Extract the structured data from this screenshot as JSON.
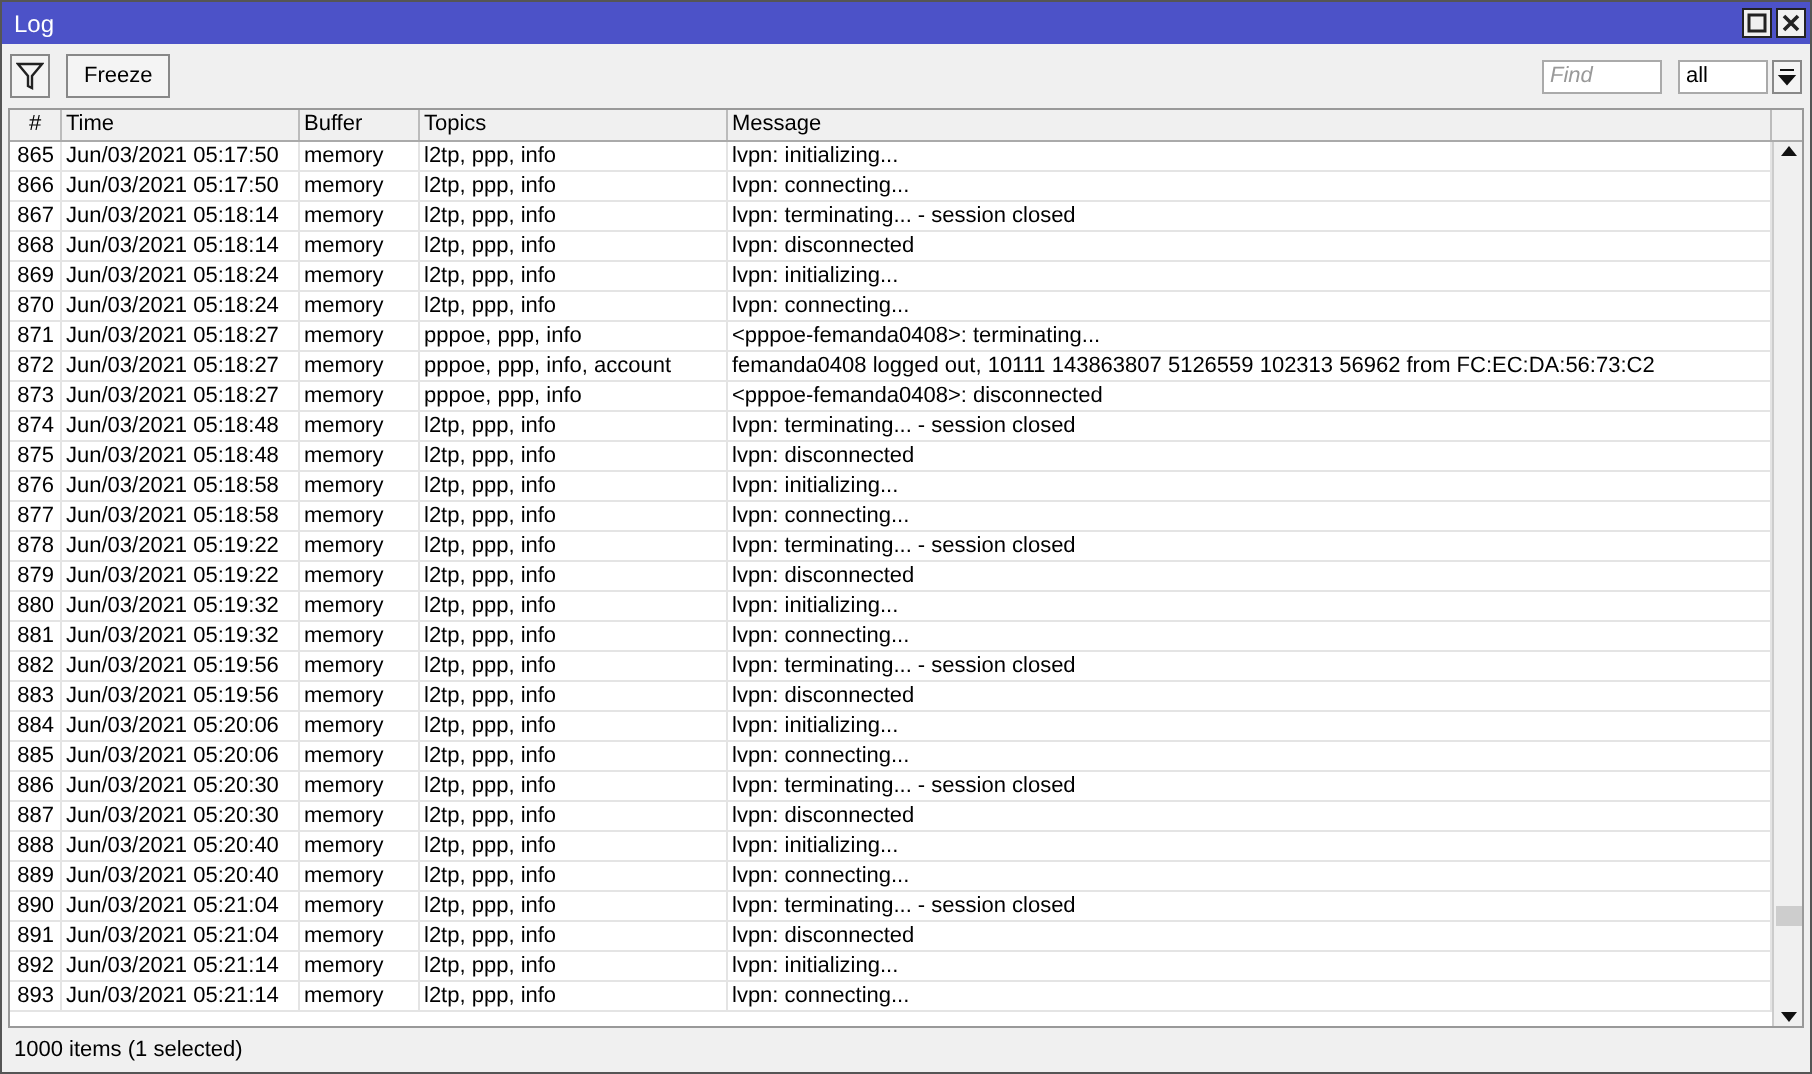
{
  "window": {
    "title": "Log"
  },
  "toolbar": {
    "freeze_button": "Freeze",
    "find": {
      "placeholder": "Find"
    },
    "filter_select": {
      "value": "all"
    }
  },
  "table": {
    "columns": [
      "#",
      "Time",
      "Buffer",
      "Topics",
      "Message"
    ],
    "rows": [
      {
        "num": "865",
        "time": "Jun/03/2021 05:17:50",
        "buffer": "memory",
        "topics": "l2tp, ppp, info",
        "message": "lvpn: initializing..."
      },
      {
        "num": "866",
        "time": "Jun/03/2021 05:17:50",
        "buffer": "memory",
        "topics": "l2tp, ppp, info",
        "message": "lvpn: connecting..."
      },
      {
        "num": "867",
        "time": "Jun/03/2021 05:18:14",
        "buffer": "memory",
        "topics": "l2tp, ppp, info",
        "message": "lvpn: terminating... - session closed"
      },
      {
        "num": "868",
        "time": "Jun/03/2021 05:18:14",
        "buffer": "memory",
        "topics": "l2tp, ppp, info",
        "message": "lvpn: disconnected"
      },
      {
        "num": "869",
        "time": "Jun/03/2021 05:18:24",
        "buffer": "memory",
        "topics": "l2tp, ppp, info",
        "message": "lvpn: initializing..."
      },
      {
        "num": "870",
        "time": "Jun/03/2021 05:18:24",
        "buffer": "memory",
        "topics": "l2tp, ppp, info",
        "message": "lvpn: connecting..."
      },
      {
        "num": "871",
        "time": "Jun/03/2021 05:18:27",
        "buffer": "memory",
        "topics": "pppoe, ppp, info",
        "message": "<pppoe-femanda0408>: terminating..."
      },
      {
        "num": "872",
        "time": "Jun/03/2021 05:18:27",
        "buffer": "memory",
        "topics": "pppoe, ppp, info, account",
        "message": "femanda0408 logged out, 10111 143863807 5126559 102313 56962 from FC:EC:DA:56:73:C2"
      },
      {
        "num": "873",
        "time": "Jun/03/2021 05:18:27",
        "buffer": "memory",
        "topics": "pppoe, ppp, info",
        "message": "<pppoe-femanda0408>: disconnected"
      },
      {
        "num": "874",
        "time": "Jun/03/2021 05:18:48",
        "buffer": "memory",
        "topics": "l2tp, ppp, info",
        "message": "lvpn: terminating... - session closed"
      },
      {
        "num": "875",
        "time": "Jun/03/2021 05:18:48",
        "buffer": "memory",
        "topics": "l2tp, ppp, info",
        "message": "lvpn: disconnected"
      },
      {
        "num": "876",
        "time": "Jun/03/2021 05:18:58",
        "buffer": "memory",
        "topics": "l2tp, ppp, info",
        "message": "lvpn: initializing..."
      },
      {
        "num": "877",
        "time": "Jun/03/2021 05:18:58",
        "buffer": "memory",
        "topics": "l2tp, ppp, info",
        "message": "lvpn: connecting..."
      },
      {
        "num": "878",
        "time": "Jun/03/2021 05:19:22",
        "buffer": "memory",
        "topics": "l2tp, ppp, info",
        "message": "lvpn: terminating... - session closed"
      },
      {
        "num": "879",
        "time": "Jun/03/2021 05:19:22",
        "buffer": "memory",
        "topics": "l2tp, ppp, info",
        "message": "lvpn: disconnected"
      },
      {
        "num": "880",
        "time": "Jun/03/2021 05:19:32",
        "buffer": "memory",
        "topics": "l2tp, ppp, info",
        "message": "lvpn: initializing..."
      },
      {
        "num": "881",
        "time": "Jun/03/2021 05:19:32",
        "buffer": "memory",
        "topics": "l2tp, ppp, info",
        "message": "lvpn: connecting..."
      },
      {
        "num": "882",
        "time": "Jun/03/2021 05:19:56",
        "buffer": "memory",
        "topics": "l2tp, ppp, info",
        "message": "lvpn: terminating... - session closed"
      },
      {
        "num": "883",
        "time": "Jun/03/2021 05:19:56",
        "buffer": "memory",
        "topics": "l2tp, ppp, info",
        "message": "lvpn: disconnected"
      },
      {
        "num": "884",
        "time": "Jun/03/2021 05:20:06",
        "buffer": "memory",
        "topics": "l2tp, ppp, info",
        "message": "lvpn: initializing..."
      },
      {
        "num": "885",
        "time": "Jun/03/2021 05:20:06",
        "buffer": "memory",
        "topics": "l2tp, ppp, info",
        "message": "lvpn: connecting..."
      },
      {
        "num": "886",
        "time": "Jun/03/2021 05:20:30",
        "buffer": "memory",
        "topics": "l2tp, ppp, info",
        "message": "lvpn: terminating... - session closed"
      },
      {
        "num": "887",
        "time": "Jun/03/2021 05:20:30",
        "buffer": "memory",
        "topics": "l2tp, ppp, info",
        "message": "lvpn: disconnected"
      },
      {
        "num": "888",
        "time": "Jun/03/2021 05:20:40",
        "buffer": "memory",
        "topics": "l2tp, ppp, info",
        "message": "lvpn: initializing..."
      },
      {
        "num": "889",
        "time": "Jun/03/2021 05:20:40",
        "buffer": "memory",
        "topics": "l2tp, ppp, info",
        "message": "lvpn: connecting..."
      },
      {
        "num": "890",
        "time": "Jun/03/2021 05:21:04",
        "buffer": "memory",
        "topics": "l2tp, ppp, info",
        "message": "lvpn: terminating... - session closed"
      },
      {
        "num": "891",
        "time": "Jun/03/2021 05:21:04",
        "buffer": "memory",
        "topics": "l2tp, ppp, info",
        "message": "lvpn: disconnected"
      },
      {
        "num": "892",
        "time": "Jun/03/2021 05:21:14",
        "buffer": "memory",
        "topics": "l2tp, ppp, info",
        "message": "lvpn: initializing..."
      },
      {
        "num": "893",
        "time": "Jun/03/2021 05:21:14",
        "buffer": "memory",
        "topics": "l2tp, ppp, info",
        "message": "lvpn: connecting..."
      }
    ]
  },
  "status_bar": "1000 items (1 selected)"
}
